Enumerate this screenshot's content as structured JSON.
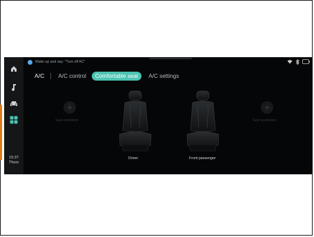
{
  "rail": {
    "items": [
      {
        "icon": "home-icon"
      },
      {
        "icon": "music-note-icon"
      },
      {
        "icon": "car-icon"
      },
      {
        "icon": "apps-grid-icon",
        "active": true
      }
    ],
    "time": "10:37",
    "day": "Thurs"
  },
  "status_bar": {
    "voice_hint": "Wake up and say: \"Turn off AC\"",
    "icons": [
      "wifi-icon",
      "bluetooth-icon",
      "battery-icon"
    ]
  },
  "tabs": {
    "title": "A/C",
    "items": [
      {
        "label": "A/C control",
        "active": false
      },
      {
        "label": "Comfortable seat",
        "active": true
      },
      {
        "label": "A/C settings",
        "active": false
      }
    ]
  },
  "seats": {
    "left_ventilation_label": "Seat ventilation",
    "right_ventilation_label": "Seat ventilation",
    "driver_label": "Driver",
    "passenger_label": "Front passenger"
  },
  "colors": {
    "accent": "#4cc3b2",
    "background": "#050607",
    "rail": "#141618",
    "side_marker": "#e07b16"
  }
}
